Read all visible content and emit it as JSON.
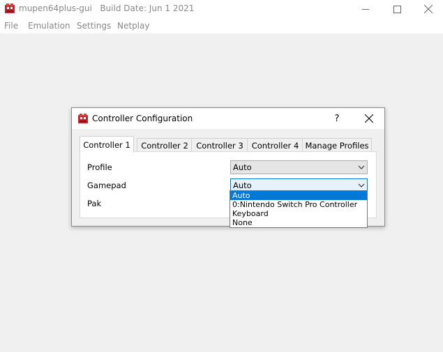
{
  "window": {
    "app_name": "mupen64plus-gui",
    "build_date": "Build Date: Jun  1 2021",
    "icon": "mupen64plus-app-icon",
    "controls": [
      "minimize-icon",
      "maximize-icon",
      "close-icon"
    ]
  },
  "menubar": {
    "items": [
      {
        "label": "File"
      },
      {
        "label": "Emulation"
      },
      {
        "label": "Settings"
      },
      {
        "label": "Netplay"
      }
    ]
  },
  "dialog": {
    "title": "Controller Configuration",
    "help_label": "?",
    "icon": "mupen64plus-app-icon",
    "tabs": [
      {
        "label": "Controller 1",
        "active": true
      },
      {
        "label": "Controller 2",
        "active": false
      },
      {
        "label": "Controller 3",
        "active": false
      },
      {
        "label": "Controller 4",
        "active": false
      },
      {
        "label": "Manage Profiles",
        "active": false
      }
    ],
    "fields": {
      "profile": {
        "label": "Profile",
        "value": "Auto"
      },
      "gamepad": {
        "label": "Gamepad",
        "value": "Auto"
      },
      "pak": {
        "label": "Pak"
      }
    },
    "gamepad_options": [
      {
        "label": "Auto",
        "selected": true
      },
      {
        "label": "0:Nintendo Switch Pro Controller",
        "selected": false
      },
      {
        "label": "Keyboard",
        "selected": false
      },
      {
        "label": "None",
        "selected": false
      }
    ]
  },
  "colors": {
    "accent": "#0078d7",
    "focused_combo_bg": "#e5f1fb",
    "app_bg": "#f0f0f0",
    "icon_red": "#c8232c"
  }
}
